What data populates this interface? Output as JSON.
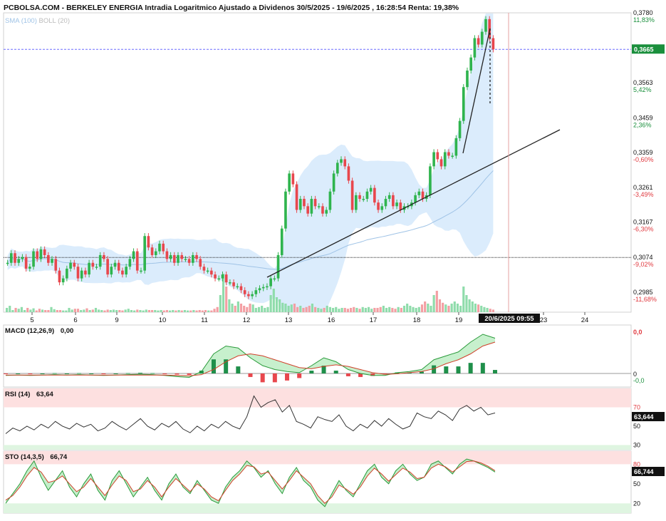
{
  "header": {
    "title": "PCBOLSA.COM - BERKELEY ENERGIA Intradia Logaritmico Ajustado a Dividenos 30/5/2025 - 19/6/2025 , 16:28:54 Renta: 19,38%",
    "sma_label": "SMA (100)",
    "boll_label": "BOLL (20)"
  },
  "colors": {
    "up": "#2fb44e",
    "down": "#e8474d",
    "band_fill": "#cfe6fb",
    "sma": "#9fc3e6",
    "pos_pct": "#1a8f3c",
    "neg_pct": "#e0393f"
  },
  "chart_data": {
    "type": "candlestick",
    "price_axis": {
      "scale": "log",
      "ticks": [
        "0,3780",
        "0,3670",
        "0,3563",
        "0,3459",
        "0,3359",
        "0,3261",
        "0,3167",
        "0,3074",
        "0,2985"
      ],
      "tick_values": [
        0.378,
        0.367,
        0.3563,
        0.3459,
        0.3359,
        0.3261,
        0.3167,
        0.3074,
        0.2985
      ],
      "pct_labels": [
        "11,83%",
        "",
        "5,42%",
        "2,36%",
        "-0,60%",
        "-3,49%",
        "-6,30%",
        "-9,02%",
        "-11,68%"
      ],
      "range": [
        0.2935,
        0.378
      ]
    },
    "x_axis": {
      "ticks": [
        "5",
        "6",
        "9",
        "10",
        "11",
        "12",
        "13",
        "16",
        "17",
        "18",
        "19",
        "23",
        "24"
      ],
      "cursor_label": "20/6/2025 09:55"
    },
    "last_price_label": "0,3665",
    "last_price": 0.3665,
    "reference_price": 0.3074,
    "ohlc": [
      {
        "d": "5",
        "s": [
          0.306,
          0.3085,
          0.306,
          0.307,
          0.3075,
          0.3045,
          0.305,
          0.309,
          0.307,
          0.3095,
          0.308,
          0.306
        ]
      },
      {
        "d": "6",
        "s": [
          0.307,
          0.304,
          0.301,
          0.302,
          0.3045,
          0.306,
          0.305,
          0.302,
          0.304,
          0.303,
          0.306,
          0.305
        ]
      },
      {
        "d": "9",
        "s": [
          0.305,
          0.308,
          0.307,
          0.303,
          0.305,
          0.306,
          0.304,
          0.303,
          0.305,
          0.307,
          0.309,
          0.304
        ]
      },
      {
        "d": "10",
        "s": [
          0.304,
          0.313,
          0.31,
          0.308,
          0.309,
          0.311,
          0.309,
          0.307,
          0.308,
          0.306,
          0.308,
          0.307
        ]
      },
      {
        "d": "11",
        "s": [
          0.307,
          0.306,
          0.308,
          0.307,
          0.305,
          0.304,
          0.304,
          0.303,
          0.302,
          0.302,
          0.303,
          0.301
        ]
      },
      {
        "d": "12",
        "s": [
          0.301,
          0.3,
          0.3,
          0.299,
          0.298,
          0.2975,
          0.298,
          0.299,
          0.2995,
          0.2998,
          0.3,
          0.302
        ]
      },
      {
        "d": "13",
        "s": [
          0.302,
          0.308,
          0.315,
          0.325,
          0.33,
          0.327,
          0.32,
          0.323,
          0.321,
          0.319,
          0.323,
          0.321
        ]
      },
      {
        "d": "16",
        "s": [
          0.321,
          0.319,
          0.32,
          0.325,
          0.33,
          0.333,
          0.334,
          0.332,
          0.328,
          0.32,
          0.324,
          0.323
        ]
      },
      {
        "d": "17",
        "s": [
          0.323,
          0.325,
          0.326,
          0.322,
          0.32,
          0.321,
          0.323,
          0.324,
          0.321,
          0.322,
          0.32,
          0.321
        ]
      },
      {
        "d": "18",
        "s": [
          0.321,
          0.322,
          0.324,
          0.325,
          0.323,
          0.324,
          0.332,
          0.336,
          0.334,
          0.332,
          0.336,
          0.335
        ]
      },
      {
        "d": "19",
        "s": [
          0.335,
          0.34,
          0.345,
          0.355,
          0.36,
          0.364,
          0.37,
          0.368,
          0.372,
          0.376,
          0.37,
          0.3665
        ]
      }
    ],
    "volume_levels": [
      0.1,
      0.15,
      0.05,
      0.1,
      0.08,
      0.12,
      0.05,
      0.1,
      0.06,
      0.09,
      0.04,
      0.08,
      0.06,
      0.05,
      0.05,
      0.12,
      0.07,
      0.05,
      0.05,
      0.04,
      0.04,
      0.1,
      0.06,
      0.08,
      0.08,
      0.05,
      0.06,
      0.09,
      0.05,
      0.06,
      0.1,
      0.06,
      0.05,
      0.04,
      0.06,
      0.05,
      0.06,
      0.05,
      0.05,
      0.04,
      0.06,
      0.08,
      0.05,
      0.04,
      0.06,
      0.05,
      0.04,
      0.06,
      0.05,
      0.05,
      0.05,
      0.04,
      0.05,
      0.04,
      0.05,
      0.04,
      0.05,
      0.04,
      0.05,
      0.04,
      0.05,
      0.04,
      0.04,
      0.05,
      0.04,
      0.05,
      0.04,
      0.05,
      0.04,
      0.04,
      0.08,
      0.12,
      0.4,
      0.9,
      0.6,
      0.3,
      0.2,
      0.15,
      0.25,
      0.2,
      0.15,
      0.12,
      0.2,
      0.18,
      0.1,
      0.12,
      0.15,
      0.1,
      0.12,
      0.4,
      0.55,
      0.35,
      0.3,
      0.22,
      0.2,
      0.15,
      0.18,
      0.2,
      0.12,
      0.15,
      0.1,
      0.12,
      0.15,
      0.2,
      0.12,
      0.1,
      0.08,
      0.1,
      0.15,
      0.12,
      0.1,
      0.12,
      0.08,
      0.1,
      0.1,
      0.08,
      0.1,
      0.12,
      0.1,
      0.08,
      0.12,
      0.1,
      0.12,
      0.08,
      0.1,
      0.1,
      0.12,
      0.15,
      0.1,
      0.12,
      0.1,
      0.08,
      0.12,
      0.1,
      0.15,
      0.2,
      0.15,
      0.12,
      0.1,
      0.12,
      0.18,
      0.25,
      0.2,
      0.15,
      0.4,
      0.5,
      0.3,
      0.22,
      0.18,
      0.15,
      0.2,
      0.25,
      0.2,
      0.15,
      0.6,
      0.4,
      0.3,
      0.25,
      0.2,
      0.18,
      0.15,
      0.12,
      0.1,
      0.08,
      0.06
    ],
    "macd": {
      "label": "MACD (12,26,9)",
      "value": "0,00",
      "axis_ticks": [
        "0,0",
        "0",
        "-0,0"
      ],
      "line": [
        -0.05,
        -0.04,
        -0.05,
        -0.04,
        -0.03,
        -0.04,
        -0.03,
        -0.04,
        -0.05,
        -0.04,
        -0.03,
        -0.02,
        -0.03,
        -0.05,
        -0.08,
        -0.1,
        0.05,
        0.5,
        0.7,
        0.65,
        0.4,
        0.2,
        0.1,
        0.05,
        0.02,
        0.2,
        0.4,
        0.3,
        0.1,
        0.0,
        -0.05,
        -0.05,
        0.02,
        0.05,
        0.1,
        0.35,
        0.45,
        0.55,
        0.8,
        1.0,
        0.9
      ],
      "signal": [
        -0.04,
        -0.04,
        -0.04,
        -0.04,
        -0.04,
        -0.04,
        -0.04,
        -0.04,
        -0.04,
        -0.04,
        -0.04,
        -0.04,
        -0.04,
        -0.04,
        -0.05,
        -0.06,
        -0.03,
        0.1,
        0.3,
        0.45,
        0.5,
        0.45,
        0.35,
        0.25,
        0.15,
        0.12,
        0.18,
        0.22,
        0.18,
        0.1,
        0.02,
        -0.02,
        -0.01,
        0.02,
        0.05,
        0.12,
        0.25,
        0.35,
        0.5,
        0.7,
        0.8
      ]
    },
    "rsi": {
      "label": "RSI (14)",
      "value": "63,64",
      "current_label": "63,644",
      "axis_ticks": [
        "70",
        "50",
        "30"
      ],
      "tick_values": [
        70,
        50,
        30
      ],
      "series": [
        42,
        48,
        45,
        50,
        46,
        52,
        48,
        55,
        50,
        47,
        53,
        49,
        52,
        45,
        48,
        55,
        50,
        46,
        52,
        58,
        50,
        46,
        53,
        49,
        55,
        47,
        43,
        50,
        45,
        52,
        48,
        55,
        50,
        47,
        60,
        82,
        70,
        75,
        78,
        65,
        72,
        55,
        52,
        48,
        60,
        57,
        55,
        62,
        50,
        45,
        52,
        48,
        56,
        50,
        58,
        52,
        47,
        50,
        64,
        60,
        58,
        66,
        62,
        56,
        68,
        72,
        66,
        70,
        62,
        64
      ]
    },
    "sto": {
      "label": "STO (14,3,5)",
      "value": "66,74",
      "current_label": "66,744",
      "axis_ticks": [
        "80",
        "50",
        "20"
      ],
      "tick_values": [
        80,
        50,
        20
      ],
      "k": [
        20,
        35,
        50,
        70,
        85,
        60,
        40,
        55,
        70,
        45,
        30,
        50,
        65,
        40,
        25,
        55,
        70,
        50,
        30,
        45,
        60,
        40,
        25,
        50,
        65,
        45,
        35,
        55,
        40,
        25,
        20,
        45,
        60,
        70,
        85,
        75,
        60,
        70,
        50,
        35,
        60,
        75,
        55,
        45,
        25,
        15,
        35,
        55,
        40,
        30,
        50,
        70,
        80,
        60,
        50,
        70,
        80,
        65,
        55,
        60,
        80,
        85,
        75,
        65,
        80,
        88,
        85,
        80,
        75,
        68
      ],
      "d": [
        25,
        32,
        45,
        62,
        75,
        68,
        52,
        55,
        62,
        50,
        38,
        45,
        58,
        45,
        32,
        48,
        62,
        55,
        38,
        42,
        55,
        45,
        30,
        45,
        58,
        48,
        38,
        50,
        42,
        30,
        24,
        40,
        55,
        65,
        78,
        76,
        65,
        68,
        55,
        42,
        55,
        70,
        60,
        50,
        32,
        20,
        30,
        48,
        42,
        34,
        45,
        62,
        74,
        65,
        54,
        64,
        74,
        68,
        58,
        60,
        74,
        80,
        76,
        68,
        76,
        84,
        85,
        82,
        77,
        70
      ]
    }
  },
  "sidebar_stub": "0,3665"
}
